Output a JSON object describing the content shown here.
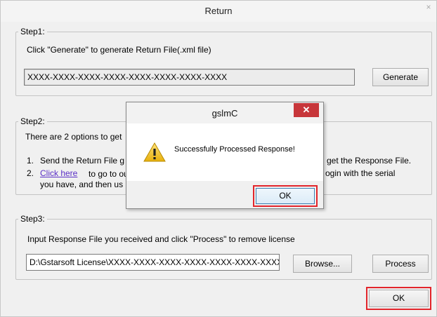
{
  "window": {
    "title": "Return",
    "close_glyph": "×"
  },
  "step1": {
    "legend": "Step1:",
    "instruction": "Click \"Generate\" to generate Return File(.xml file)",
    "serial_value": "XXXX-XXXX-XXXX-XXXX-XXXX-XXXX-XXXX-XXXX",
    "generate_label": "Generate"
  },
  "step2": {
    "legend": "Step2:",
    "intro": "There are 2 options to get",
    "item1_num": "1.",
    "item1_text": "Send the Return File g",
    "item1_tail": "get the Response File.",
    "item2_num": "2.",
    "item2_link": "Click here",
    "item2_text": "to go to ou",
    "item2_tail": "ogin with the serial",
    "item2_line2": "you have, and then us"
  },
  "step3": {
    "legend": "Step3:",
    "instruction": "Input Response File you received and click \"Process\" to remove license",
    "path_value": "D:\\Gstarsoft License\\XXXX-XXXX-XXXX-XXXX-XXXX-XXXX-XXXX-XXX",
    "browse_label": "Browse...",
    "process_label": "Process"
  },
  "footer": {
    "ok_label": "OK"
  },
  "dialog": {
    "title": "gslmC",
    "close_glyph": "✕",
    "message": "Successfully Processed Response!",
    "ok_label": "OK",
    "icon": "warning-icon"
  },
  "colors": {
    "highlight": "#e2252b",
    "link": "#5a2fc6",
    "close_red": "#c7363a"
  }
}
